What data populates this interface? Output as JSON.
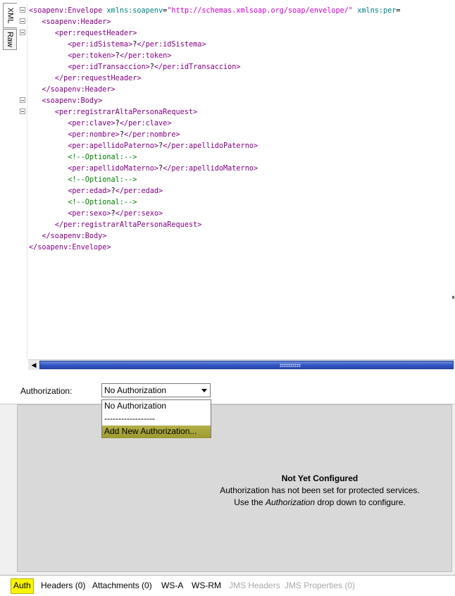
{
  "editor": {
    "side_tabs": [
      "XML",
      "Raw"
    ],
    "lines": [
      [
        {
          "c": "tag",
          "t": "<soapenv:Envelope"
        },
        {
          "c": "txt",
          "t": " "
        },
        {
          "c": "attr",
          "t": "xmlns:soapenv"
        },
        {
          "c": "txt",
          "t": "="
        },
        {
          "c": "val",
          "t": "\"http://schemas.xmlsoap.org/soap/envelope/\""
        },
        {
          "c": "txt",
          "t": " "
        },
        {
          "c": "attr",
          "t": "xmlns:per"
        },
        {
          "c": "txt",
          "t": "="
        }
      ],
      [
        {
          "c": "txt",
          "t": "   "
        },
        {
          "c": "tag",
          "t": "<soapenv:Header>"
        }
      ],
      [
        {
          "c": "txt",
          "t": "      "
        },
        {
          "c": "tag",
          "t": "<per:requestHeader>"
        }
      ],
      [
        {
          "c": "txt",
          "t": "         "
        },
        {
          "c": "tag",
          "t": "<per:idSistema>"
        },
        {
          "c": "txt",
          "t": "?"
        },
        {
          "c": "tag",
          "t": "</per:idSistema>"
        }
      ],
      [
        {
          "c": "txt",
          "t": "         "
        },
        {
          "c": "tag",
          "t": "<per:token>"
        },
        {
          "c": "txt",
          "t": "?"
        },
        {
          "c": "tag",
          "t": "</per:token>"
        }
      ],
      [
        {
          "c": "txt",
          "t": "         "
        },
        {
          "c": "tag",
          "t": "<per:idTransaccion>"
        },
        {
          "c": "txt",
          "t": "?"
        },
        {
          "c": "tag",
          "t": "</per:idTransaccion>"
        }
      ],
      [
        {
          "c": "txt",
          "t": "      "
        },
        {
          "c": "tag",
          "t": "</per:requestHeader>"
        }
      ],
      [
        {
          "c": "txt",
          "t": "   "
        },
        {
          "c": "tag",
          "t": "</soapenv:Header>"
        }
      ],
      [
        {
          "c": "txt",
          "t": "   "
        },
        {
          "c": "tag",
          "t": "<soapenv:Body>"
        }
      ],
      [
        {
          "c": "txt",
          "t": "      "
        },
        {
          "c": "tag",
          "t": "<per:registrarAltaPersonaRequest>"
        }
      ],
      [
        {
          "c": "txt",
          "t": "         "
        },
        {
          "c": "tag",
          "t": "<per:clave>"
        },
        {
          "c": "txt",
          "t": "?"
        },
        {
          "c": "tag",
          "t": "</per:clave>"
        }
      ],
      [
        {
          "c": "txt",
          "t": "         "
        },
        {
          "c": "tag",
          "t": "<per:nombre>"
        },
        {
          "c": "txt",
          "t": "?"
        },
        {
          "c": "tag",
          "t": "</per:nombre>"
        }
      ],
      [
        {
          "c": "txt",
          "t": "         "
        },
        {
          "c": "tag",
          "t": "<per:apellidoPaterno>"
        },
        {
          "c": "txt",
          "t": "?"
        },
        {
          "c": "tag",
          "t": "</per:apellidoPaterno>"
        }
      ],
      [
        {
          "c": "txt",
          "t": "         "
        },
        {
          "c": "com",
          "t": "<!--Optional:-->"
        }
      ],
      [
        {
          "c": "txt",
          "t": "         "
        },
        {
          "c": "tag",
          "t": "<per:apellidoMaterno>"
        },
        {
          "c": "txt",
          "t": "?"
        },
        {
          "c": "tag",
          "t": "</per:apellidoMaterno>"
        }
      ],
      [
        {
          "c": "txt",
          "t": "         "
        },
        {
          "c": "com",
          "t": "<!--Optional:-->"
        }
      ],
      [
        {
          "c": "txt",
          "t": "         "
        },
        {
          "c": "tag",
          "t": "<per:edad>"
        },
        {
          "c": "txt",
          "t": "?"
        },
        {
          "c": "tag",
          "t": "</per:edad>"
        }
      ],
      [
        {
          "c": "txt",
          "t": "         "
        },
        {
          "c": "com",
          "t": "<!--Optional:-->"
        }
      ],
      [
        {
          "c": "txt",
          "t": "         "
        },
        {
          "c": "tag",
          "t": "<per:sexo>"
        },
        {
          "c": "txt",
          "t": "?"
        },
        {
          "c": "tag",
          "t": "</per:sexo>"
        }
      ],
      [
        {
          "c": "txt",
          "t": "      "
        },
        {
          "c": "tag",
          "t": "</per:registrarAltaPersonaRequest>"
        }
      ],
      [
        {
          "c": "txt",
          "t": "   "
        },
        {
          "c": "tag",
          "t": "</soapenv:Body>"
        }
      ],
      [
        {
          "c": "tag",
          "t": "</soapenv:Envelope>"
        }
      ]
    ]
  },
  "auth": {
    "label": "Authorization:",
    "selected": "No Authorization",
    "options": [
      "No Authorization",
      "------------------",
      "Add New Authorization..."
    ]
  },
  "panel": {
    "title": "Not Yet Configured",
    "line1": "Authorization has not been set for protected services.",
    "line2_pre": "Use the ",
    "line2_em": "Authorization",
    "line2_post": " drop down to configure."
  },
  "bottom_tabs": [
    {
      "label": "Auth",
      "state": "active"
    },
    {
      "label": "Headers (0)",
      "state": "normal"
    },
    {
      "label": "Attachments (0)",
      "state": "normal"
    },
    {
      "label": "WS-A",
      "state": "normal"
    },
    {
      "label": "WS-RM",
      "state": "normal"
    },
    {
      "label": "JMS Headers",
      "state": "disabled"
    },
    {
      "label": "JMS Properties (0)",
      "state": "disabled"
    }
  ],
  "colors": {
    "tag": "#800080",
    "attribute": "#008080",
    "value": "#cc00cc",
    "comment": "#008000",
    "active_tab": "#f8f400",
    "dropdown_highlight": "#aaa83a",
    "scroll_thumb": "#2f55c4"
  },
  "icons": {
    "fold": "fold-toggle-icon",
    "scroll_left": "arrow-left-icon",
    "dropdown": "chevron-down-icon"
  }
}
